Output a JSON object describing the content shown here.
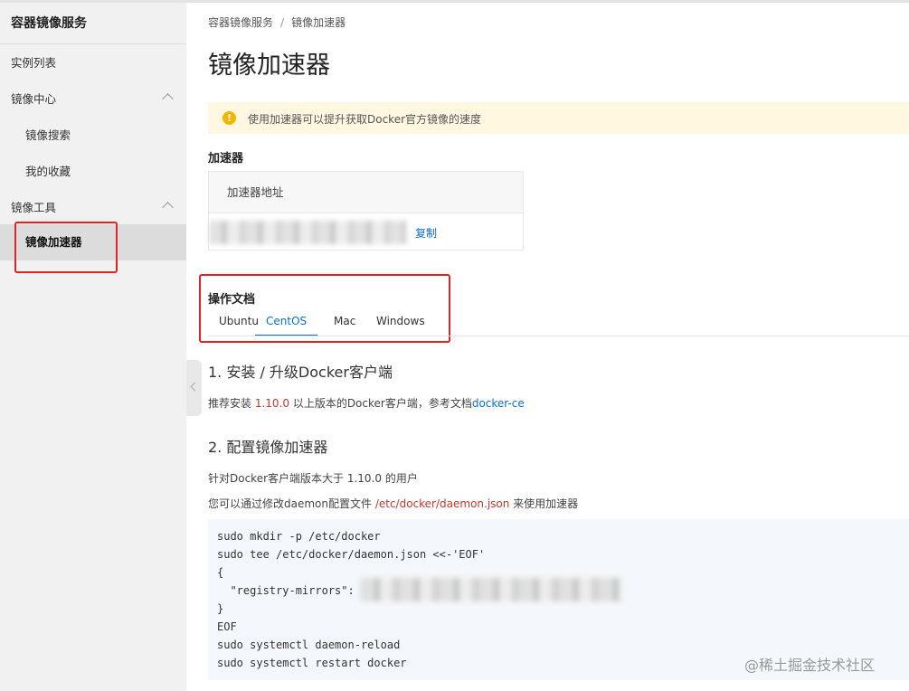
{
  "sidebar": {
    "title": "容器镜像服务",
    "items": [
      {
        "label": "实例列表"
      },
      {
        "label": "镜像中心"
      },
      {
        "label": "镜像搜索"
      },
      {
        "label": "我的收藏"
      },
      {
        "label": "镜像工具"
      },
      {
        "label": "镜像加速器"
      }
    ]
  },
  "breadcrumb": {
    "root": "容器镜像服务",
    "separator": "/",
    "current": "镜像加速器"
  },
  "page_title": "镜像加速器",
  "notice": {
    "text": "使用加速器可以提升获取Docker官方镜像的速度",
    "icon": "warning-icon"
  },
  "accelerator": {
    "heading": "加速器",
    "column_header": "加速器地址",
    "copy_label": "复制"
  },
  "docs": {
    "heading": "操作文档",
    "tabs": [
      "Ubuntu",
      "CentOS",
      "Mac",
      "Windows"
    ],
    "active_tab": "CentOS"
  },
  "section1": {
    "title": "1. 安装 / 升级Docker客户端",
    "text_before": "推荐安装 ",
    "version": "1.10.0",
    "text_after": " 以上版本的Docker客户端，参考文档",
    "link": "docker-ce"
  },
  "section2": {
    "title": "2. 配置镜像加速器",
    "line1": "针对Docker客户端版本大于 1.10.0 的用户",
    "line2_before": "您可以通过修改daemon配置文件 ",
    "line2_path": "/etc/docker/daemon.json",
    "line2_after": " 来使用加速器"
  },
  "code": {
    "lines": [
      "sudo mkdir -p /etc/docker",
      "sudo tee /etc/docker/daemon.json <<-'EOF'",
      "{",
      "  \"registry-mirrors\": ",
      "}",
      "EOF",
      "sudo systemctl daemon-reload",
      "sudo systemctl restart docker"
    ]
  },
  "watermark": "@稀土掘金技术社区"
}
